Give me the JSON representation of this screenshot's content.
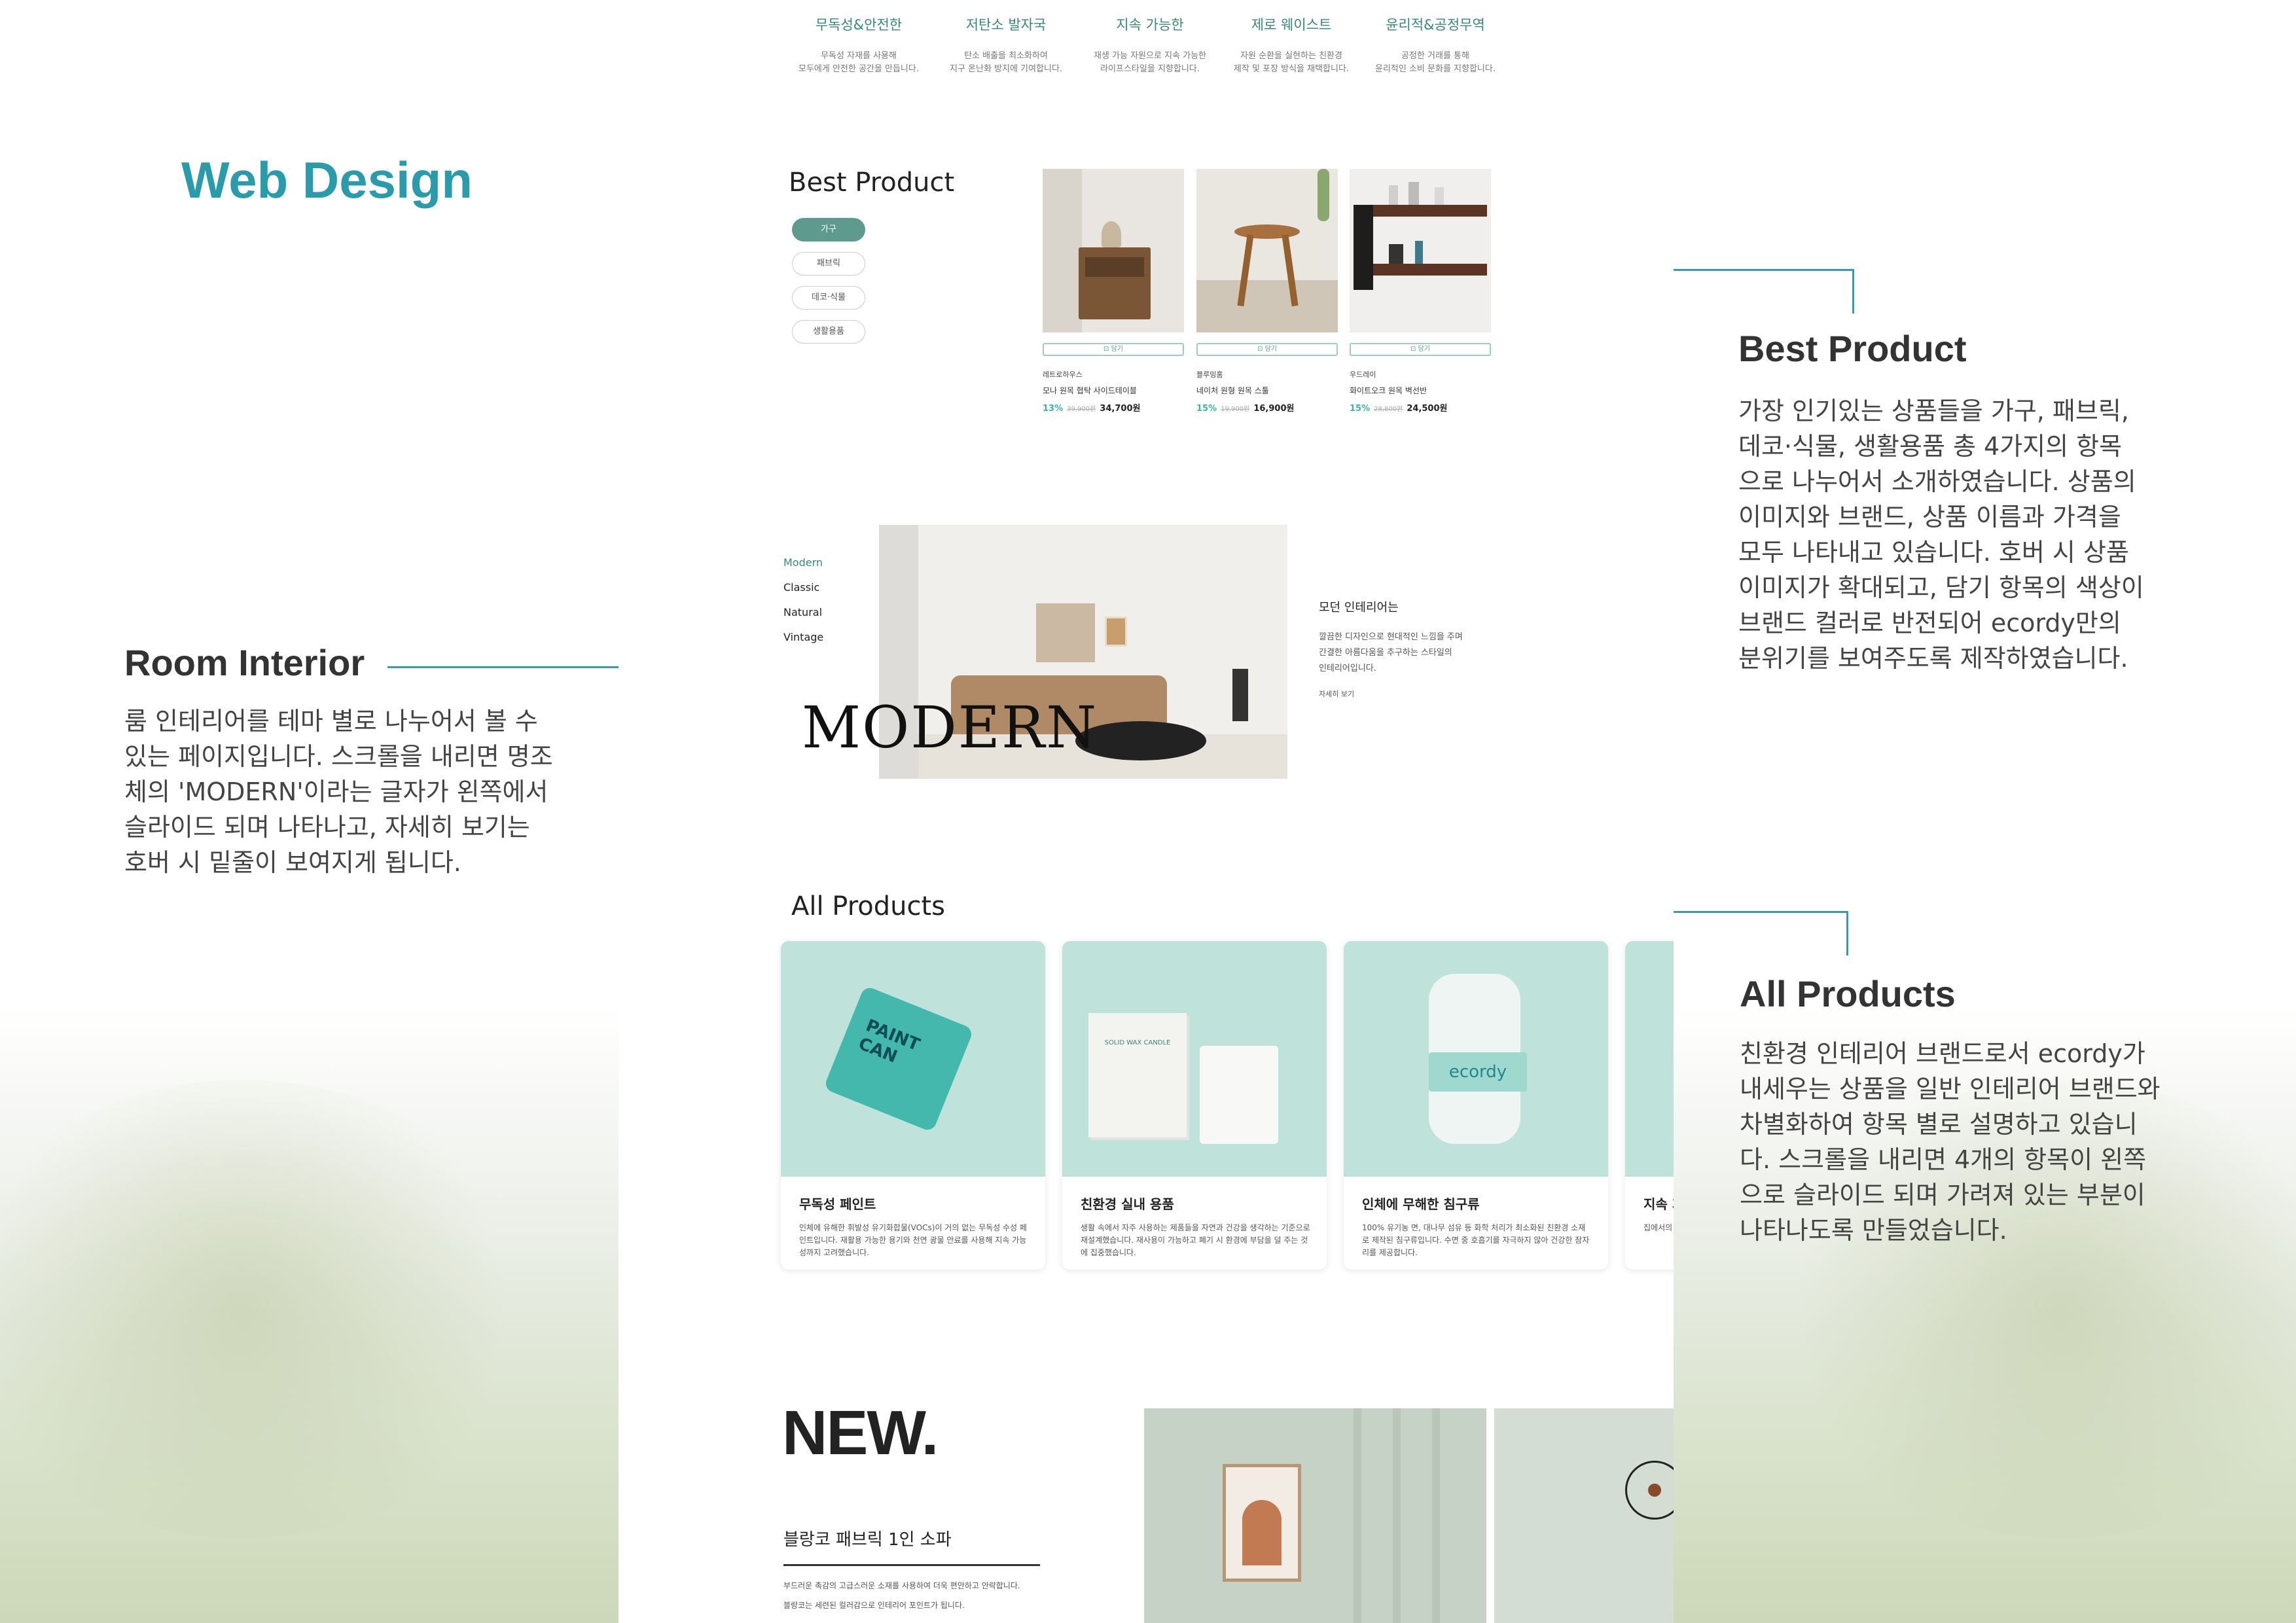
{
  "heading": "Web Design",
  "values": [
    {
      "title": "무독성&안전한",
      "desc1": "무독성 자재를 사용해",
      "desc2": "모두에게 안전한 공간을 만듭니다."
    },
    {
      "title": "저탄소 발자국",
      "desc1": "탄소 배출을 최소화하여",
      "desc2": "지구 온난화 방지에 기여합니다."
    },
    {
      "title": "지속 가능한",
      "desc1": "재생 가능 자원으로 지속 가능한",
      "desc2": "라이프스타일을 지향합니다."
    },
    {
      "title": "제로 웨이스트",
      "desc1": "자원 순환을 실현하는 친환경",
      "desc2": "제작 및 포장 방식을 채택합니다."
    },
    {
      "title": "윤리적&공정무역",
      "desc1": "공정한 거래를 통해",
      "desc2": "윤리적인 소비 문화를 지향합니다."
    }
  ],
  "best_product": {
    "title": "Best Product",
    "categories": [
      "가구",
      "패브릭",
      "데코·식물",
      "생활용품"
    ],
    "cart_label": "담기",
    "products": [
      {
        "brand": "레트로하우스",
        "name": "모나 원목 협탁 사이드테이블",
        "discount": "13%",
        "old_price": "39,900원",
        "price": "34,700원"
      },
      {
        "brand": "블루밍홈",
        "name": "네이처 원형 원목 스툴",
        "discount": "15%",
        "old_price": "19,900원",
        "price": "16,900원"
      },
      {
        "brand": "우드레이",
        "name": "화이트오크 원목 벽선반",
        "discount": "15%",
        "old_price": "28,800원",
        "price": "24,500원"
      }
    ]
  },
  "room_interior": {
    "menu": [
      "Modern",
      "Classic",
      "Natural",
      "Vintage"
    ],
    "overlay_word": "MODERN",
    "desc_title": "모던 인테리어는",
    "desc_lines": [
      "깔끔한 디자인으로 현대적인 느낌을 주며",
      "간결한 아름다움을 추구하는 스타일의",
      "인테리어입니다."
    ],
    "more_link": "자세히 보기"
  },
  "all_products": {
    "title": "All Products",
    "items": [
      {
        "title": "무독성 페인트",
        "desc": "인체에 유해한 휘발성 유기화합물(VOCs)이 거의 없는 무독성 수성 페인트입니다. 재활용 가능한 용기와 천연 광물 안료를 사용해 지속 가능성까지 고려했습니다.",
        "label": "PAINT CAN"
      },
      {
        "title": "친환경 실내 용품",
        "desc": "생활 속에서 자주 사용하는 제품들을 자연과 건강을 생각하는 기준으로 재설계했습니다. 재사용이 가능하고 폐기 시 환경에 부담을 덜 주는 것에 집중했습니다.",
        "label": "SOLID WAX CANDLE"
      },
      {
        "title": "인체에 무해한 침구류",
        "desc": "100% 유기농 면, 대나무 섬유 등 화학 처리가 최소화된 친환경 소재로 제작된 침구류입니다. 수면 중 호흡기를 자극하지 않아 건강한 잠자리를 제공합니다.",
        "label": "ecordy"
      },
      {
        "title": "지속 가능",
        "desc": "집에서의 사용 및 재활용 속 가능한",
        "label": ""
      }
    ]
  },
  "new_section": {
    "title": "NEW.",
    "product": "블랑코 패브릭 1인 소파",
    "desc1": "부드러운 촉감의 고급스러운 소재를 사용하여 더욱 편안하고 안락합니다.",
    "desc2": "블랑코는 세련된 컬러감으로 인테리어 포인트가 됩니다."
  },
  "annotations": {
    "best_product": {
      "title": "Best Product",
      "lines": [
        "가장 인기있는 상품들을 가구, 패브릭,",
        "데코·식물, 생활용품 총 4가지의 항목",
        "으로 나누어서 소개하였습니다. 상품의",
        "이미지와 브랜드, 상품 이름과 가격을",
        "모두 나타내고 있습니다. 호버 시 상품",
        "이미지가 확대되고, 담기 항목의 색상이",
        "브랜드 컬러로 반전되어 ecordy만의",
        "분위기를 보여주도록 제작하였습니다."
      ]
    },
    "room_interior": {
      "title": "Room Interior",
      "lines": [
        "룸 인테리어를 테마 별로 나누어서 볼 수",
        "있는 페이지입니다. 스크롤을 내리면 명조",
        "체의 'MODERN'이라는 글자가 왼쪽에서",
        "슬라이드 되며 나타나고, 자세히 보기는",
        "호버 시 밑줄이 보여지게 됩니다."
      ]
    },
    "all_products": {
      "title": "All Products",
      "lines": [
        "친환경 인테리어 브랜드로서 ecordy가",
        "내세우는 상품을 일반 인테리어 브랜드와",
        "차별화하여 항목 별로 설명하고 있습니",
        "다. 스크롤을 내리면 4개의 항목이 왼쪽",
        "으로 슬라이드 되며 가려져 있는 부분이",
        "나타나도록 만들었습니다."
      ]
    }
  },
  "colors": {
    "brand": "#2a9bab",
    "accent_green": "#5e9a8e",
    "mint": "#bfe3db"
  }
}
